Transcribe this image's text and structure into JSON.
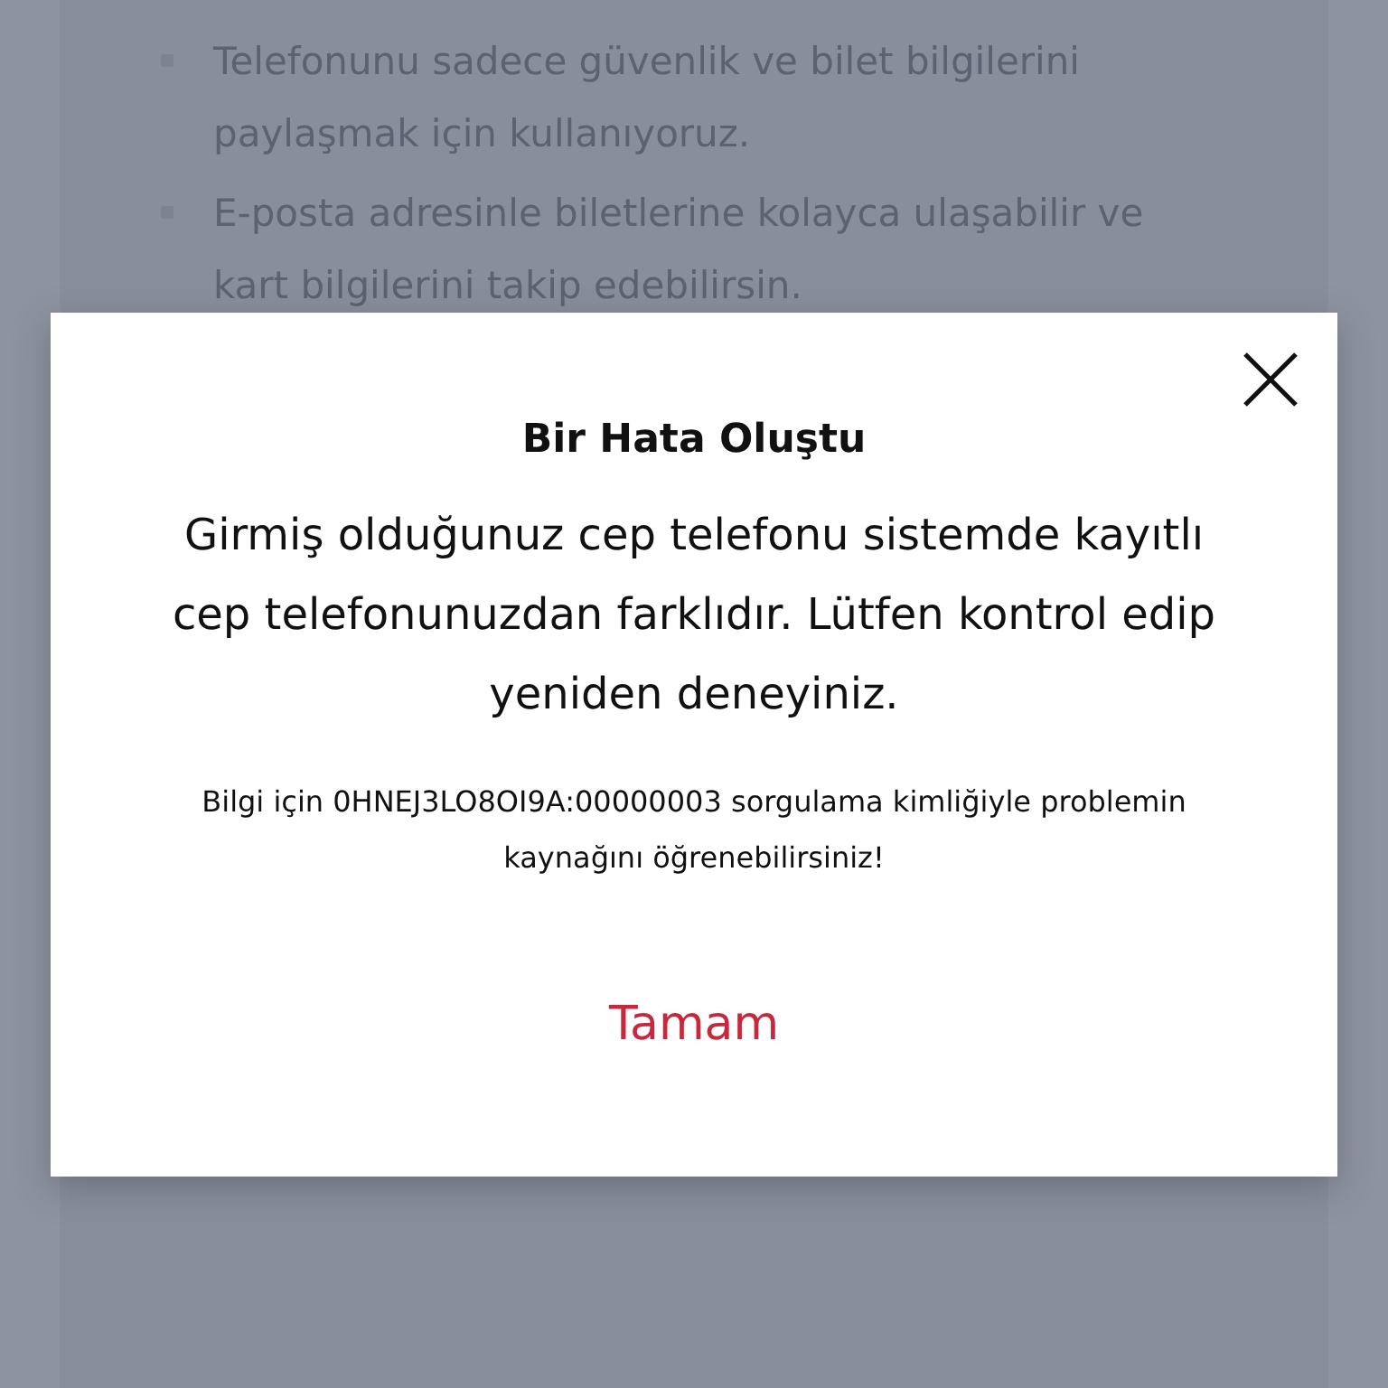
{
  "background_list": [
    "Telefonunu sadece güvenlik ve bilet bilgilerini paylaşmak için kullanıyoruz.",
    "E-posta adresinle biletlerine kolayca ulaşabilir ve kart bilgilerini takip edebilirsin."
  ],
  "dialog": {
    "title": "Bir Hata Oluştu",
    "message": "Girmiş olduğunuz cep telefonu sistemde kayıtlı cep telefonunuzdan farklıdır. Lütfen kontrol edip yeniden deneyiniz.",
    "info": "Bilgi için 0HNEJ3LO8OI9A:00000003 sorgulama kimliğiyle problemin kaynağını öğrenebilirsiniz!",
    "button": "Tamam"
  }
}
